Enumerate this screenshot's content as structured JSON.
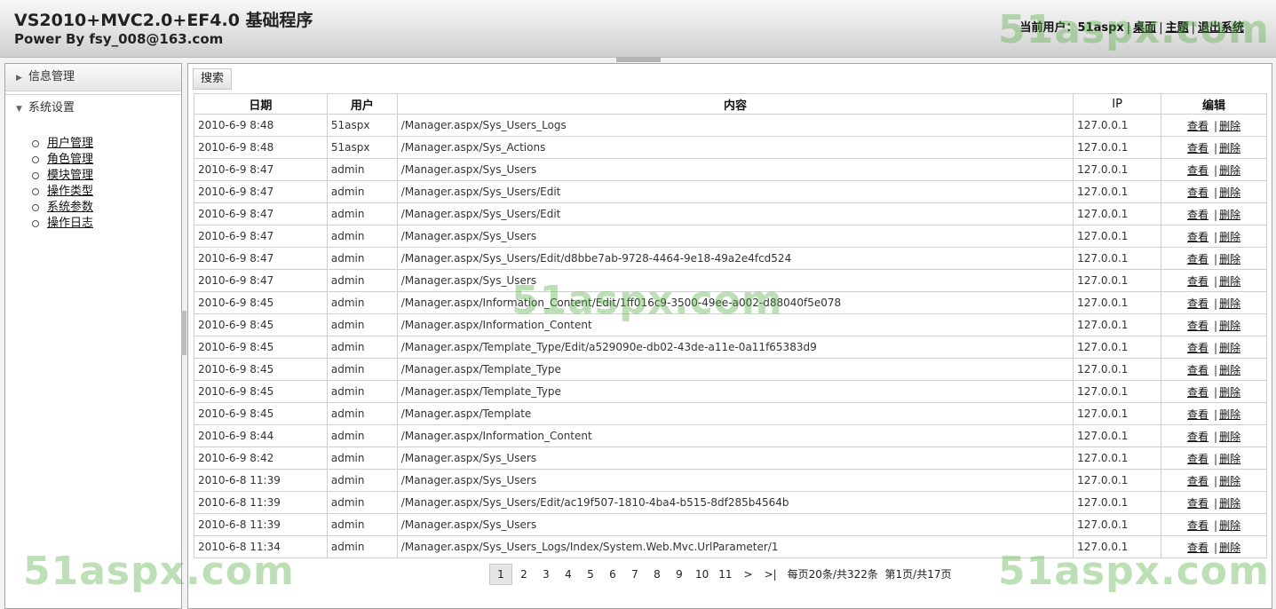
{
  "header": {
    "title": "VS2010+MVC2.0+EF4.0 基础程序",
    "subtitle": "Power By fsy_008@163.com",
    "user_label": "当前用户：51aspx",
    "desktop": "桌面",
    "theme": "主题",
    "logout": "退出系统"
  },
  "sidebar": {
    "panel1": "信息管理",
    "panel2": "系统设置",
    "menu": [
      "用户管理",
      "角色管理",
      "模块管理",
      "操作类型",
      "系统参数",
      "操作日志"
    ]
  },
  "toolbar": {
    "search": "搜索"
  },
  "table": {
    "headers": {
      "date": "日期",
      "user": "用户",
      "content": "内容",
      "ip": "IP",
      "edit": "编辑"
    },
    "view_label": "查看",
    "delete_label": "删除",
    "rows": [
      {
        "date": "2010-6-9 8:48",
        "user": "51aspx",
        "content": "/Manager.aspx/Sys_Users_Logs",
        "ip": "127.0.0.1"
      },
      {
        "date": "2010-6-9 8:48",
        "user": "51aspx",
        "content": "/Manager.aspx/Sys_Actions",
        "ip": "127.0.0.1"
      },
      {
        "date": "2010-6-9 8:47",
        "user": "admin",
        "content": "/Manager.aspx/Sys_Users",
        "ip": "127.0.0.1"
      },
      {
        "date": "2010-6-9 8:47",
        "user": "admin",
        "content": "/Manager.aspx/Sys_Users/Edit",
        "ip": "127.0.0.1"
      },
      {
        "date": "2010-6-9 8:47",
        "user": "admin",
        "content": "/Manager.aspx/Sys_Users/Edit",
        "ip": "127.0.0.1"
      },
      {
        "date": "2010-6-9 8:47",
        "user": "admin",
        "content": "/Manager.aspx/Sys_Users",
        "ip": "127.0.0.1"
      },
      {
        "date": "2010-6-9 8:47",
        "user": "admin",
        "content": "/Manager.aspx/Sys_Users/Edit/d8bbe7ab-9728-4464-9e18-49a2e4fcd524",
        "ip": "127.0.0.1"
      },
      {
        "date": "2010-6-9 8:47",
        "user": "admin",
        "content": "/Manager.aspx/Sys_Users",
        "ip": "127.0.0.1"
      },
      {
        "date": "2010-6-9 8:45",
        "user": "admin",
        "content": "/Manager.aspx/Information_Content/Edit/1ff016c9-3500-49ee-a002-d88040f5e078",
        "ip": "127.0.0.1"
      },
      {
        "date": "2010-6-9 8:45",
        "user": "admin",
        "content": "/Manager.aspx/Information_Content",
        "ip": "127.0.0.1"
      },
      {
        "date": "2010-6-9 8:45",
        "user": "admin",
        "content": "/Manager.aspx/Template_Type/Edit/a529090e-db02-43de-a11e-0a11f65383d9",
        "ip": "127.0.0.1"
      },
      {
        "date": "2010-6-9 8:45",
        "user": "admin",
        "content": "/Manager.aspx/Template_Type",
        "ip": "127.0.0.1"
      },
      {
        "date": "2010-6-9 8:45",
        "user": "admin",
        "content": "/Manager.aspx/Template_Type",
        "ip": "127.0.0.1"
      },
      {
        "date": "2010-6-9 8:45",
        "user": "admin",
        "content": "/Manager.aspx/Template",
        "ip": "127.0.0.1"
      },
      {
        "date": "2010-6-9 8:44",
        "user": "admin",
        "content": "/Manager.aspx/Information_Content",
        "ip": "127.0.0.1"
      },
      {
        "date": "2010-6-9 8:42",
        "user": "admin",
        "content": "/Manager.aspx/Sys_Users",
        "ip": "127.0.0.1"
      },
      {
        "date": "2010-6-8 11:39",
        "user": "admin",
        "content": "/Manager.aspx/Sys_Users",
        "ip": "127.0.0.1"
      },
      {
        "date": "2010-6-8 11:39",
        "user": "admin",
        "content": "/Manager.aspx/Sys_Users/Edit/ac19f507-1810-4ba4-b515-8df285b4564b",
        "ip": "127.0.0.1"
      },
      {
        "date": "2010-6-8 11:39",
        "user": "admin",
        "content": "/Manager.aspx/Sys_Users",
        "ip": "127.0.0.1"
      },
      {
        "date": "2010-6-8 11:34",
        "user": "admin",
        "content": "/Manager.aspx/Sys_Users_Logs/Index/System.Web.Mvc.UrlParameter/1",
        "ip": "127.0.0.1"
      }
    ]
  },
  "pager": {
    "pages": [
      "1",
      "2",
      "3",
      "4",
      "5",
      "6",
      "7",
      "8",
      "9",
      "10",
      "11"
    ],
    "current": "1",
    "next": ">",
    "last": ">|",
    "summary": "每页20条/共322条",
    "position": "第1页/共17页"
  },
  "watermark": {
    "text": "51aspx.com"
  }
}
